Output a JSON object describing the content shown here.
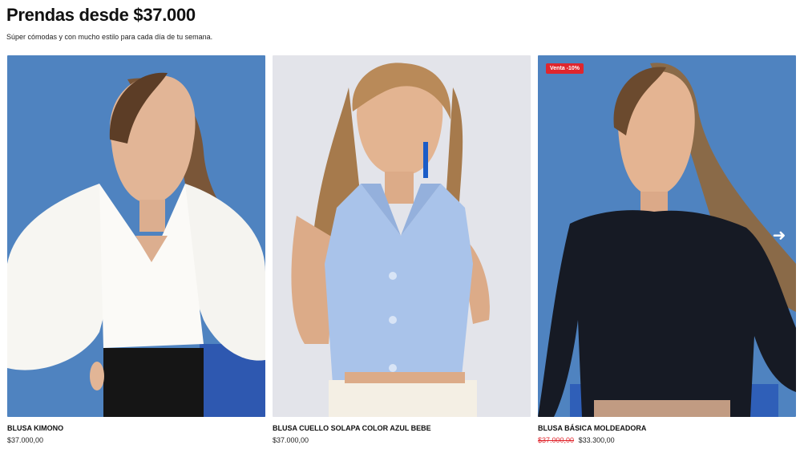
{
  "section": {
    "title": "Prendas desde $37.000",
    "subtitle": "Súper cómodas y con mucho estilo para cada día de tu semana."
  },
  "products": [
    {
      "name": "BLUSA KIMONO",
      "price": "$37.000,00",
      "old_price": "",
      "badge": "",
      "image_background": "#4f83c0",
      "image_alt": "blusa-kimono-photo"
    },
    {
      "name": "BLUSA CUELLO SOLAPA COLOR AZUL BEBE",
      "price": "$37.000,00",
      "old_price": "",
      "badge": "",
      "image_background": "#e3e4ea",
      "image_alt": "blusa-solapa-photo"
    },
    {
      "name": "BLUSA BÁSICA MOLDEADORA",
      "price": "$33.300,00",
      "old_price": "$37.000,00",
      "badge": "Venta -10%",
      "image_background": "#4f83c0",
      "image_alt": "blusa-moldeadora-photo"
    }
  ],
  "carousel": {
    "next_icon": "arrow-right-icon"
  },
  "colors": {
    "sale_badge": "#e0262d",
    "sale_price_strike": "#e0262d"
  }
}
